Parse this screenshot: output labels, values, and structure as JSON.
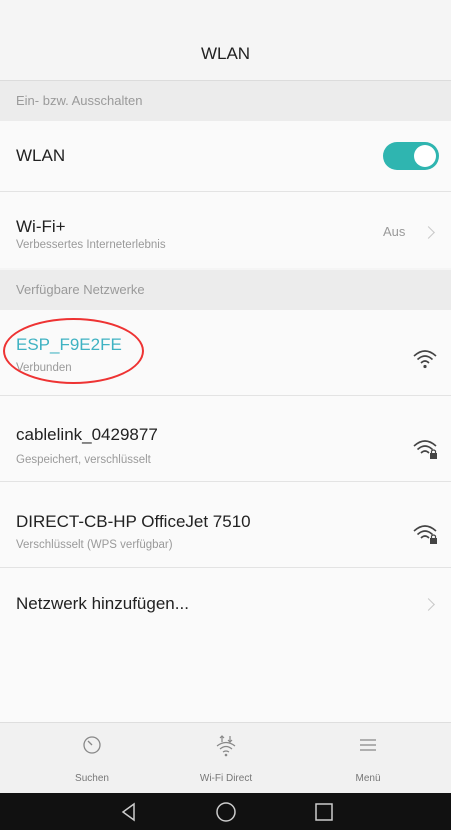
{
  "header": {
    "title": "WLAN"
  },
  "sections": {
    "toggle_section": "Ein- bzw. Ausschalten",
    "networks_section": "Verfügbare Netzwerke"
  },
  "wlan_row": {
    "label": "WLAN",
    "enabled": true
  },
  "wifiplus_row": {
    "label": "Wi-Fi+",
    "subtitle": "Verbessertes Interneterlebnis",
    "value": "Aus"
  },
  "networks": [
    {
      "name": "ESP_F9E2FE",
      "status": "Verbunden",
      "icon": "wifi-signal-icon"
    },
    {
      "name": "cablelink_0429877",
      "status": "Gespeichert, verschlüsselt",
      "icon": "wifi-locked-icon"
    },
    {
      "name": "DIRECT-CB-HP OfficeJet 7510",
      "status": "Verschlüsselt (WPS verfügbar)",
      "icon": "wifi-locked-icon"
    }
  ],
  "add_network": {
    "label": "Netzwerk hinzufügen..."
  },
  "bottom_nav": {
    "search": "Suchen",
    "wifi_direct": "Wi-Fi Direct",
    "menu": "Menü"
  },
  "colors": {
    "accent": "#2fb5b0",
    "connected_text": "#3fb2c2",
    "annotation": "#e33333"
  }
}
